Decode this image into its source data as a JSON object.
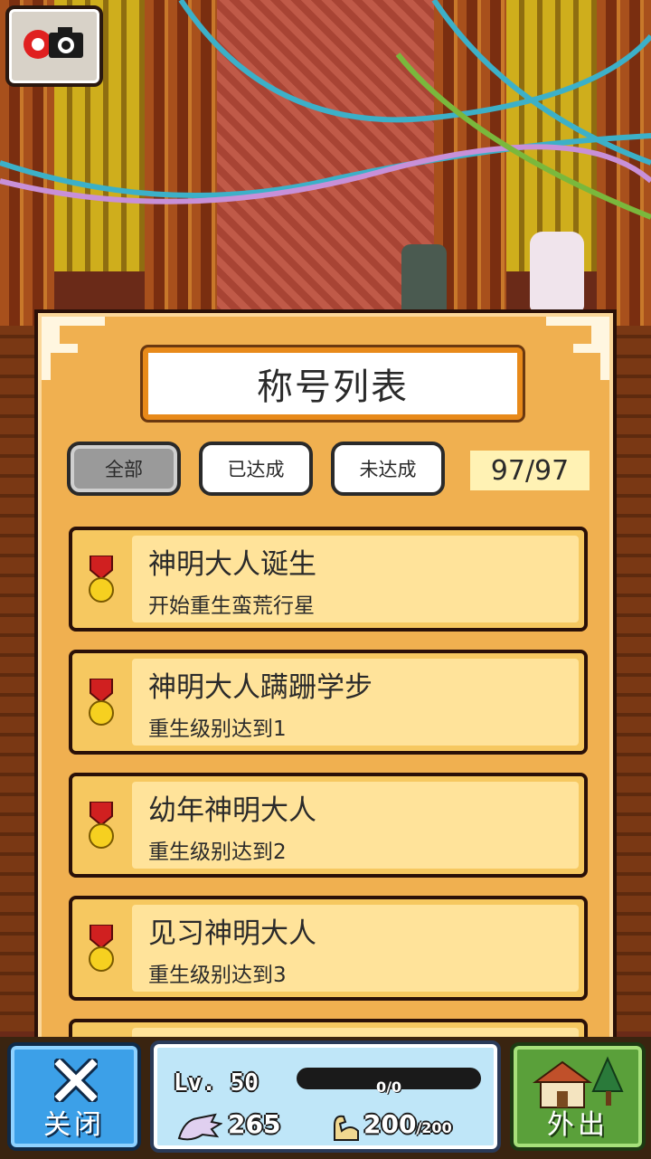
{
  "panel": {
    "title": "称号列表",
    "tabs": [
      {
        "label": "全部",
        "selected": true
      },
      {
        "label": "已达成",
        "selected": false
      },
      {
        "label": "未达成",
        "selected": false
      }
    ],
    "counter": "97/97"
  },
  "titles": [
    {
      "name": "神明大人诞生",
      "desc": "开始重生蛮荒行星"
    },
    {
      "name": "神明大人蹒跚学步",
      "desc": "重生级别达到1"
    },
    {
      "name": "幼年神明大人",
      "desc": "重生级别达到2"
    },
    {
      "name": "见习神明大人",
      "desc": "重生级别达到3"
    }
  ],
  "status": {
    "level": "Lv. 50",
    "exp": "0/0",
    "exp_fraction": 0,
    "souls": "265",
    "stamina": "200",
    "stamina_max": "/200"
  },
  "buttons": {
    "close": "关闭",
    "go_out": "外出"
  },
  "icons": {
    "camera": "camera-icon",
    "medal": "medal-icon",
    "close": "x-icon",
    "hand": "hand-icon",
    "arm": "arm-icon",
    "house": "house-icon"
  },
  "colors": {
    "panel": "#f0b050",
    "item": "#ffe39a",
    "close_button": "#3ca0e8",
    "out_button": "#5aa03a"
  }
}
